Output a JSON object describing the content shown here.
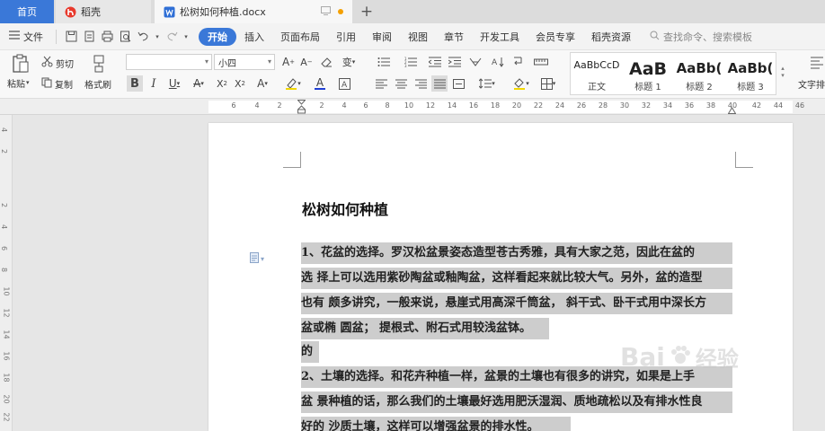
{
  "tabs": {
    "home": "首页",
    "daoke": "稻壳",
    "doc": "松树如何种植.docx"
  },
  "menu": {
    "file": "文件",
    "items": [
      "开始",
      "插入",
      "页面布局",
      "引用",
      "审阅",
      "视图",
      "章节",
      "开发工具",
      "会员专享",
      "稻壳资源"
    ],
    "search_placeholder": "查找命令、搜索模板"
  },
  "ribbon": {
    "paste": "粘贴",
    "cut": "剪切",
    "copy": "复制",
    "format_painter": "格式刷",
    "font_name": "",
    "font_size": "小四",
    "styles": [
      {
        "preview": "AaBbCcD",
        "name": "正文"
      },
      {
        "preview": "AaB",
        "name": "标题 1"
      },
      {
        "preview": "AaBb(",
        "name": "标题 2"
      },
      {
        "preview": "AaBb(",
        "name": "标题 3"
      }
    ],
    "text_layout": "文字排"
  },
  "ruler": {
    "ticks": [
      "6",
      "4",
      "2",
      "2",
      "4",
      "6",
      "8",
      "10",
      "12",
      "14",
      "16",
      "18",
      "20",
      "22",
      "24",
      "26",
      "28",
      "30",
      "32",
      "34",
      "36",
      "38",
      "40",
      "42",
      "44",
      "46"
    ],
    "vticks": [
      "4",
      "2",
      "2",
      "4",
      "6",
      "8",
      "10",
      "12",
      "14",
      "16",
      "18",
      "20",
      "22"
    ]
  },
  "document": {
    "title": "松树如何种植",
    "lines": [
      "1、花盆的选择。罗汉松盆景姿态造型苍古秀雅，具有大家之范，因此在盆的",
      "选  择上可以选用紫砂陶盆或釉陶盆，这样看起来就比较大气。另外，盆的造型",
      "也有  颇多讲究，一般来说，悬崖式用高深千筒盆，  斜干式、卧干式用中深长方",
      "盆或椭  圆盆；  提根式、附石式用较浅盆钵。",
      "的",
      "2、土壤的选择。和花卉种植一样，盆景的土壤也有很多的讲究，如果是上手",
      "盆  景种植的话，那么我们的土壤最好选用肥沃湿润、质地疏松以及有排水性良",
      "好的  沙质土壤，这样可以增强盆景的排水性。"
    ]
  },
  "watermark": {
    "text": "Bai",
    "sub": "经验"
  },
  "colors": {
    "accent": "#3a78d8",
    "highlight": "#cdcdcd"
  }
}
